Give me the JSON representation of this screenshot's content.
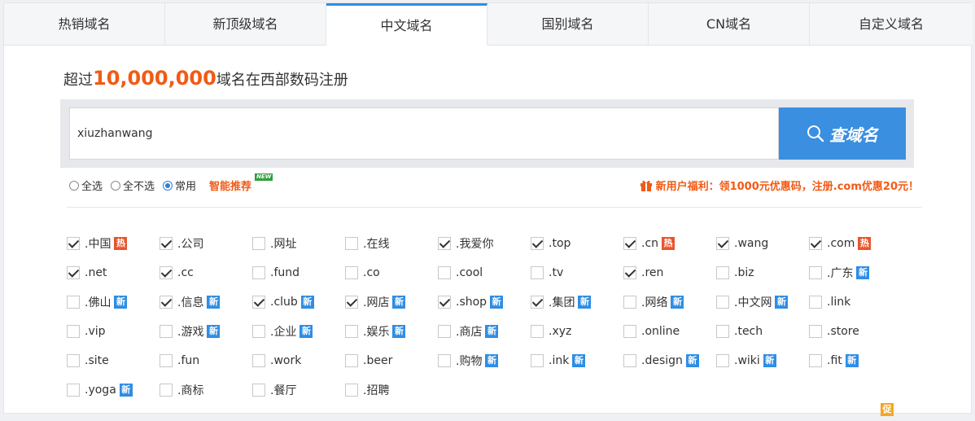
{
  "tabs": [
    {
      "label": "热销域名",
      "active": false
    },
    {
      "label": "新顶级域名",
      "active": false
    },
    {
      "label": "中文域名",
      "active": true
    },
    {
      "label": "国别域名",
      "active": false
    },
    {
      "label": "CN域名",
      "active": false
    },
    {
      "label": "自定义域名",
      "active": false
    }
  ],
  "headline": {
    "prefix": "超过",
    "count": "10,000,000",
    "suffix": "域名在西部数码注册"
  },
  "search": {
    "value": "xiuzhanwang",
    "button_label": "查域名"
  },
  "options": {
    "select_all": "全选",
    "select_none": "全不选",
    "common": "常用",
    "selected": "common",
    "smart_label": "智能推荐",
    "smart_badge": "NEW"
  },
  "promo": {
    "text": "新用户福利：领1000元优惠码，注册.com优惠20元！"
  },
  "badge_labels": {
    "hot": "热",
    "promo": "促",
    "new": "新"
  },
  "domains": [
    {
      "name": ".中国",
      "checked": true,
      "badge": "hot"
    },
    {
      "name": ".公司",
      "checked": true,
      "badge": "promo"
    },
    {
      "name": ".网址",
      "checked": false,
      "badge": "promo"
    },
    {
      "name": ".在线",
      "checked": false,
      "badge": "promo"
    },
    {
      "name": ".我爱你",
      "checked": true,
      "badge": ""
    },
    {
      "name": ".top",
      "checked": true,
      "badge": "promo"
    },
    {
      "name": ".cn",
      "checked": true,
      "badge": "hot"
    },
    {
      "name": ".wang",
      "checked": true,
      "badge": "promo"
    },
    {
      "name": ".com",
      "checked": true,
      "badge": "hot"
    },
    {
      "name": ".net",
      "checked": true,
      "badge": "promo"
    },
    {
      "name": ".cc",
      "checked": true,
      "badge": "promo"
    },
    {
      "name": ".fund",
      "checked": false,
      "badge": ""
    },
    {
      "name": ".co",
      "checked": false,
      "badge": ""
    },
    {
      "name": ".cool",
      "checked": false,
      "badge": ""
    },
    {
      "name": ".tv",
      "checked": false,
      "badge": "promo"
    },
    {
      "name": ".ren",
      "checked": true,
      "badge": "promo"
    },
    {
      "name": ".biz",
      "checked": false,
      "badge": "promo"
    },
    {
      "name": ".广东",
      "checked": false,
      "badge": "new"
    },
    {
      "name": ".佛山",
      "checked": false,
      "badge": "new"
    },
    {
      "name": ".信息",
      "checked": true,
      "badge": "new"
    },
    {
      "name": ".club",
      "checked": true,
      "badge": "new"
    },
    {
      "name": ".网店",
      "checked": true,
      "badge": "new"
    },
    {
      "name": ".shop",
      "checked": true,
      "badge": "new"
    },
    {
      "name": ".集团",
      "checked": true,
      "badge": "new"
    },
    {
      "name": ".网络",
      "checked": false,
      "badge": "new"
    },
    {
      "name": ".中文网",
      "checked": false,
      "badge": "new"
    },
    {
      "name": ".link",
      "checked": false,
      "badge": "promo"
    },
    {
      "name": ".vip",
      "checked": false,
      "badge": "promo"
    },
    {
      "name": ".游戏",
      "checked": false,
      "badge": "new"
    },
    {
      "name": ".企业",
      "checked": false,
      "badge": "new"
    },
    {
      "name": ".娱乐",
      "checked": false,
      "badge": "new"
    },
    {
      "name": ".商店",
      "checked": false,
      "badge": "new"
    },
    {
      "name": ".xyz",
      "checked": false,
      "badge": "promo"
    },
    {
      "name": ".online",
      "checked": false,
      "badge": "promo"
    },
    {
      "name": ".tech",
      "checked": false,
      "badge": "promo"
    },
    {
      "name": ".store",
      "checked": false,
      "badge": "promo"
    },
    {
      "name": ".site",
      "checked": false,
      "badge": "promo"
    },
    {
      "name": ".fun",
      "checked": false,
      "badge": "promo"
    },
    {
      "name": ".work",
      "checked": false,
      "badge": "promo"
    },
    {
      "name": ".beer",
      "checked": false,
      "badge": "promo"
    },
    {
      "name": ".购物",
      "checked": false,
      "badge": "new"
    },
    {
      "name": ".ink",
      "checked": false,
      "badge": "new"
    },
    {
      "name": ".design",
      "checked": false,
      "badge": "new"
    },
    {
      "name": ".wiki",
      "checked": false,
      "badge": "new"
    },
    {
      "name": ".fit",
      "checked": false,
      "badge": "new"
    },
    {
      "name": ".yoga",
      "checked": false,
      "badge": "new"
    },
    {
      "name": ".商标",
      "checked": false,
      "badge": ""
    },
    {
      "name": ".餐厅",
      "checked": false,
      "badge": ""
    },
    {
      "name": ".招聘",
      "checked": false,
      "badge": ""
    }
  ]
}
